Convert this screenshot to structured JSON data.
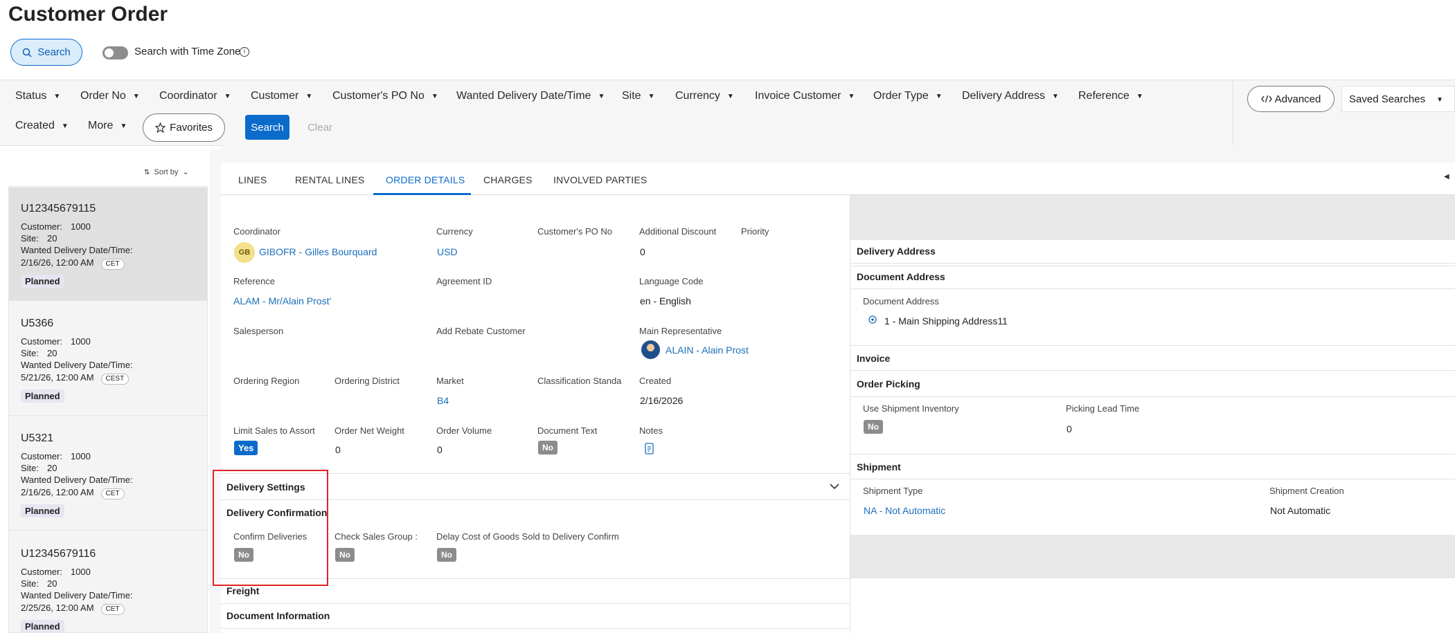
{
  "page": {
    "title": "Customer Order"
  },
  "search": {
    "button_label": "Search",
    "timezone_label": "Search with Time Zone",
    "info_glyph": "i"
  },
  "filters": {
    "row1": [
      "Status",
      "Order No",
      "Coordinator",
      "Customer",
      "Customer's PO No",
      "Wanted Delivery Date/Time",
      "Site",
      "Currency",
      "Invoice Customer",
      "Order Type",
      "Delivery Address",
      "Reference"
    ],
    "row2": [
      "Created",
      "More"
    ],
    "favorites_label": "Favorites",
    "search_label": "Search",
    "clear_label": "Clear",
    "advanced_label": "Advanced",
    "saved_searches_label": "Saved Searches"
  },
  "list": {
    "sort_label": "Sort by",
    "customer_label": "Customer:",
    "site_label": "Site:",
    "wanted_label": "Wanted Delivery Date/Time:",
    "items": [
      {
        "id": "U12345679115",
        "customer": "1000",
        "site": "20",
        "date": "2/16/26, 12:00 AM",
        "tz": "CET",
        "status": "Planned"
      },
      {
        "id": "U5366",
        "customer": "1000",
        "site": "20",
        "date": "5/21/26, 12:00 AM",
        "tz": "CEST",
        "status": "Planned"
      },
      {
        "id": "U5321",
        "customer": "1000",
        "site": "20",
        "date": "2/16/26, 12:00 AM",
        "tz": "CET",
        "status": "Planned"
      },
      {
        "id": "U12345679116",
        "customer": "1000",
        "site": "20",
        "date": "2/25/26, 12:00 AM",
        "tz": "CET",
        "status": "Planned"
      }
    ]
  },
  "tabs": [
    "LINES",
    "RENTAL LINES",
    "ORDER DETAILS",
    "CHARGES",
    "INVOLVED PARTIES"
  ],
  "active_tab": "ORDER DETAILS",
  "details": {
    "coordinator_label": "Coordinator",
    "coordinator_initials": "GB",
    "coordinator_value": "GIBOFR - Gilles Bourquard",
    "currency_label": "Currency",
    "currency_value": "USD",
    "po_label": "Customer's PO No",
    "discount_label": "Additional Discount",
    "discount_value": "0",
    "priority_label": "Priority",
    "reference_label": "Reference",
    "reference_value": "ALAM - Mr/Alain Prost'",
    "agreement_label": "Agreement ID",
    "language_label": "Language Code",
    "language_value": "en - English",
    "salesperson_label": "Salesperson",
    "rebate_label": "Add Rebate Customer",
    "mainrep_label": "Main Representative",
    "mainrep_value": "ALAIN - Alain Prost",
    "region_label": "Ordering Region",
    "district_label": "Ordering District",
    "market_label": "Market",
    "market_value": "B4",
    "classification_label": "Classification Standa",
    "created_label": "Created",
    "created_value": "2/16/2026",
    "limit_label": "Limit Sales to Assort",
    "limit_value": "Yes",
    "weight_label": "Order Net Weight",
    "weight_value": "0",
    "volume_label": "Order Volume",
    "volume_value": "0",
    "doctext_label": "Document Text",
    "doctext_value": "No",
    "notes_label": "Notes"
  },
  "delivery_settings": {
    "title": "Delivery Settings",
    "confirmation_title": "Delivery Confirmation",
    "confirm_label": "Confirm Deliveries",
    "confirm_value": "No",
    "check_label": "Check Sales Group :",
    "check_value": "No",
    "delay_label": "Delay Cost of Goods Sold to Delivery Confirm",
    "delay_value": "No"
  },
  "bottom_sections": {
    "freight": "Freight",
    "docinfo": "Document Information"
  },
  "right": {
    "delivery_address": "Delivery Address",
    "document_address": "Document Address",
    "document_address_label": "Document Address",
    "document_address_value": "1 - Main Shipping Address11",
    "invoice": "Invoice",
    "order_picking": "Order Picking",
    "use_shipment_label": "Use Shipment Inventory",
    "use_shipment_value": "No",
    "picking_lead_label": "Picking Lead Time",
    "picking_lead_value": "0",
    "shipment": "Shipment",
    "shipment_type_label": "Shipment Type",
    "shipment_type_value": "NA - Not Automatic",
    "shipment_creation_label": "Shipment Creation",
    "shipment_creation_value": "Not Automatic"
  },
  "colors": {
    "accent": "#0b6bcb",
    "highlight_box": "#e02424",
    "no_badge": "#8c8c8c"
  }
}
